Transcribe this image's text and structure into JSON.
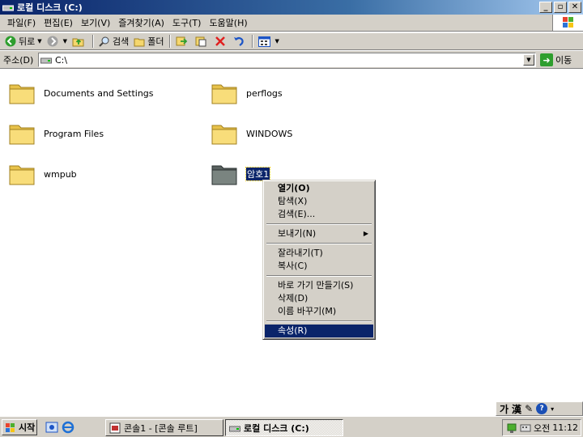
{
  "window": {
    "title": "로컬 디스크 (C:)"
  },
  "menu": [
    "파일(F)",
    "편집(E)",
    "보기(V)",
    "즐겨찾기(A)",
    "도구(T)",
    "도움말(H)"
  ],
  "toolbar": {
    "back": "뒤로",
    "search": "검색",
    "folders": "폴더"
  },
  "address": {
    "label": "주소(D)",
    "value": "C:\\",
    "go": "이동"
  },
  "items": [
    {
      "name": "Documents and Settings"
    },
    {
      "name": "perflogs"
    },
    {
      "name": "Program Files"
    },
    {
      "name": "WINDOWS"
    },
    {
      "name": "wmpub"
    },
    {
      "name": "암호1",
      "selected": true
    }
  ],
  "context_menu": {
    "open": "열기(O)",
    "explore": "탐색(X)",
    "search": "검색(E)...",
    "sendto": "보내기(N)",
    "cut": "잘라내기(T)",
    "copy": "복사(C)",
    "shortcut": "바로 가기 만들기(S)",
    "delete": "삭제(D)",
    "rename": "이름 바꾸기(M)",
    "properties": "속성(R)"
  },
  "langbar": {
    "hangul": "가",
    "hanja": "漢"
  },
  "taskbar": {
    "start": "시작",
    "tasks": [
      "콘솔1 - [콘솔 루트]",
      "로컬 디스크 (C:)"
    ],
    "ime": "오전",
    "clock": "11:12"
  },
  "colors": {
    "titlebar": "#0a246a",
    "selection": "#0a246a",
    "chrome": "#d4d0c8",
    "folder": "#f5d76e"
  }
}
